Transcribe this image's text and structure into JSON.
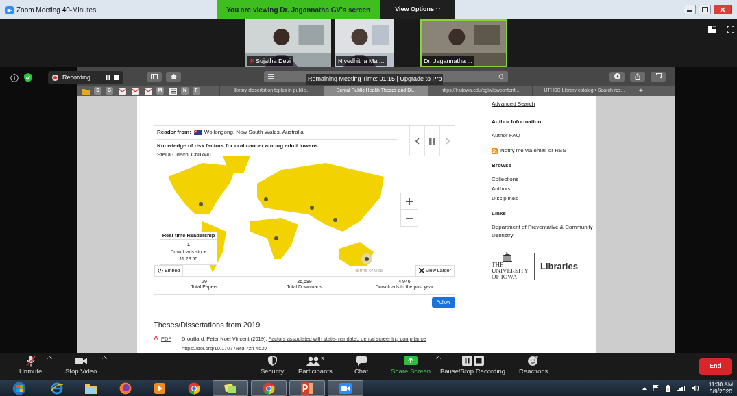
{
  "window": {
    "title": "Zoom Meeting 40-Minutes"
  },
  "share_banner": "You are viewing Dr. Jagannatha GV's screen",
  "view_options": "View Options",
  "participants": [
    {
      "name": "Sujatha Devi",
      "muted": true,
      "active_speaker": false
    },
    {
      "name": "Nivedhitha Mar...",
      "muted": false,
      "active_speaker": false
    },
    {
      "name": "Dr. Jagannatha ...",
      "muted": false,
      "active_speaker": true
    }
  ],
  "recording": {
    "label": "Recording..."
  },
  "meeting_timer": "Remaining Meeting Time: 01:15 | Upgrade to Pro",
  "bookmarks": [
    {
      "kind": "folder"
    },
    {
      "kind": "letter",
      "label": "S"
    },
    {
      "kind": "letter",
      "label": "G"
    },
    {
      "kind": "mail"
    },
    {
      "kind": "mail"
    },
    {
      "kind": "mail"
    },
    {
      "kind": "letter",
      "label": "M"
    },
    {
      "kind": "stack"
    },
    {
      "kind": "letter",
      "label": "N"
    },
    {
      "kind": "letter",
      "label": "F"
    }
  ],
  "browser_tabs": [
    {
      "label": "library dissertation topics in public...",
      "selected": false
    },
    {
      "label": "Dental Public Health Theses and Di...",
      "selected": true
    },
    {
      "label": "https://ir.uiowa.edu/cgi/viewcontent...",
      "selected": false
    },
    {
      "label": "UTHSC Library catalog › Search res...",
      "selected": false
    }
  ],
  "new_tab": "+",
  "readership": {
    "reader_from_label": "Reader from:",
    "location": "Wollongong, New South Wales, Australia",
    "paper_title": "Knowledge of risk factors for oral cancer among adult Iowans",
    "author": "Stella Ogechi Chukwu",
    "realtime_title": "Real-time Readership",
    "downloads_count": "1",
    "downloads_since": "Downloads since",
    "since_time": "11:23:55",
    "embed": "Embed",
    "terms": "Terms of Use",
    "view_larger": "View Larger",
    "stats": [
      {
        "value": "29",
        "label": "Total Papers"
      },
      {
        "value": "36,689",
        "label": "Total Downloads"
      },
      {
        "value": "4,946",
        "label": "Downloads in the past year"
      }
    ]
  },
  "follow": "Follow",
  "section_heading": "Theses/Dissertations from 2019",
  "entries": [
    {
      "format": "PDF",
      "author_year": "Drouillard, Peter Noel Vincent (2019),",
      "title": "Factors associated with state-mandated dental screening compliance",
      "doi": "https://doi.org/10.17077/etd.7zrl-4q2v"
    }
  ],
  "sidebar": [
    {
      "kind": "link",
      "text": "Advanced Search"
    },
    {
      "kind": "heading",
      "text": "Author Information"
    },
    {
      "kind": "nav",
      "text": "Author FAQ"
    },
    {
      "kind": "rss",
      "text": "Notify me via email or RSS"
    },
    {
      "kind": "heading",
      "text": "Browse"
    },
    {
      "kind": "nav",
      "text": "Collections"
    },
    {
      "kind": "nav",
      "text": "Authors"
    },
    {
      "kind": "nav",
      "text": "Disciplines"
    },
    {
      "kind": "heading",
      "text": "Links"
    },
    {
      "kind": "nav",
      "text": "Department of Preventative & Community Dentistry"
    }
  ],
  "logo": {
    "lines": [
      "THE",
      "UNIVERSITY",
      "OF IOWA"
    ],
    "libraries": "Libraries"
  },
  "toolbar": [
    {
      "kind": "mic-muted",
      "label": "Unmute",
      "caret": true
    },
    {
      "kind": "camera",
      "label": "Stop Video",
      "caret": true
    },
    {
      "kind": "shield",
      "label": "Security",
      "caret": false
    },
    {
      "kind": "people",
      "label": "Participants",
      "caret": false,
      "count": "3"
    },
    {
      "kind": "chat",
      "label": "Chat",
      "caret": false
    },
    {
      "kind": "share",
      "label": "Share Screen",
      "caret": true
    },
    {
      "kind": "record",
      "label": "Pause/Stop Recording",
      "caret": false
    },
    {
      "kind": "smiley",
      "label": "Reactions",
      "caret": false
    }
  ],
  "end_button": "End",
  "taskbar": {
    "apps": [
      {
        "kind": "ie",
        "running": false
      },
      {
        "kind": "folder",
        "running": false
      },
      {
        "kind": "firefox",
        "running": false
      },
      {
        "kind": "media",
        "running": false
      },
      {
        "kind": "chrome",
        "running": false
      },
      {
        "kind": "notes",
        "running": true
      },
      {
        "kind": "chrome",
        "running": true
      },
      {
        "kind": "powerpoint",
        "running": true
      },
      {
        "kind": "zoom",
        "running": true
      }
    ],
    "time": "11:30 AM",
    "date": "6/9/2020"
  }
}
